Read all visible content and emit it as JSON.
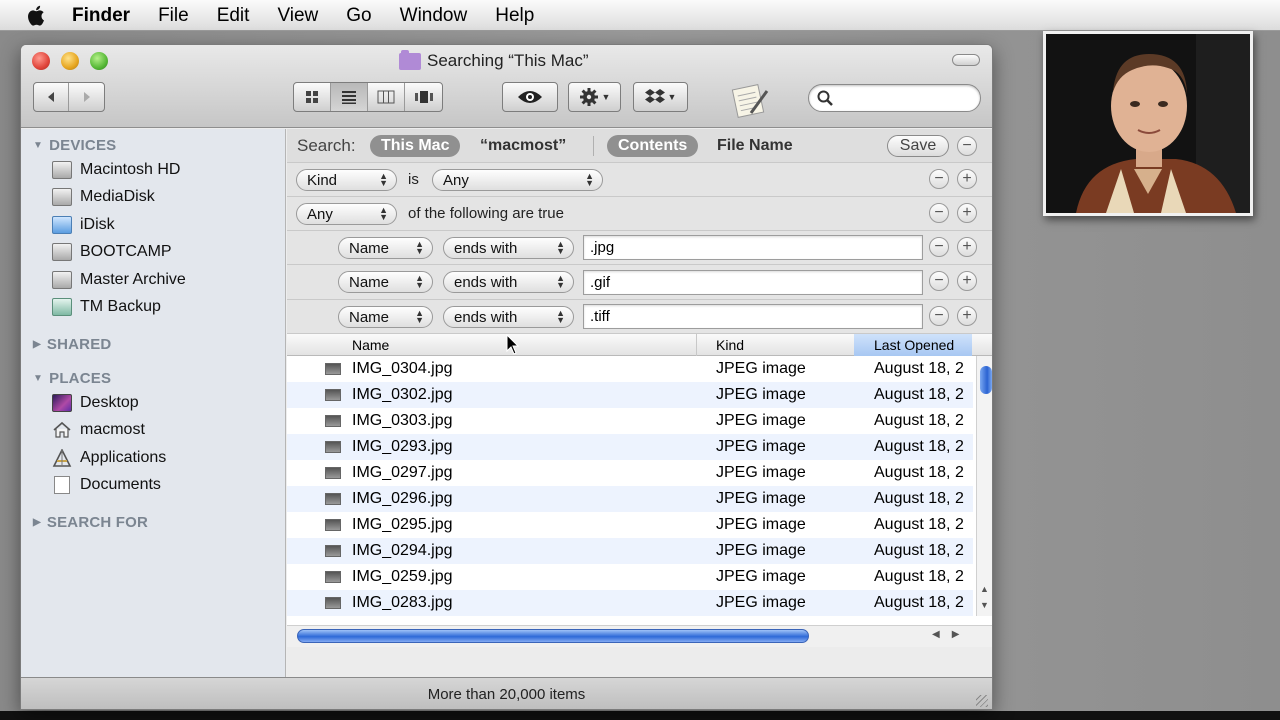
{
  "menubar": {
    "apple_icon": "apple-logo",
    "app_name": "Finder",
    "items": [
      "File",
      "Edit",
      "View",
      "Go",
      "Window",
      "Help"
    ]
  },
  "window": {
    "title": "Searching “This Mac”",
    "status": "More than 20,000 items"
  },
  "toolbar": {
    "back_icon": "back-arrow-icon",
    "forward_icon": "forward-arrow-icon",
    "view_modes": [
      "icon-view",
      "list-view",
      "column-view",
      "cover-flow-view"
    ],
    "active_view": "list-view",
    "quick_look_icon": "eye-icon",
    "action_icon": "gear-icon",
    "dropbox_icon": "dropbox-icon",
    "search": {
      "placeholder": "",
      "value": ""
    }
  },
  "sidebar": {
    "sections": [
      {
        "title": "DEVICES",
        "expanded": true,
        "items": [
          "Macintosh HD",
          "MediaDisk",
          "iDisk",
          "BOOTCAMP",
          "Master Archive",
          "TM Backup"
        ]
      },
      {
        "title": "SHARED",
        "expanded": false,
        "items": []
      },
      {
        "title": "PLACES",
        "expanded": true,
        "items": [
          "Desktop",
          "macmost",
          "Applications",
          "Documents"
        ]
      },
      {
        "title": "SEARCH FOR",
        "expanded": false,
        "items": []
      }
    ]
  },
  "search_bar": {
    "label": "Search:",
    "scope_active": "This Mac",
    "scope_other": "“macmost”",
    "attr_active": "Contents",
    "attr_other": "File Name",
    "save_label": "Save"
  },
  "criteria": {
    "row1": {
      "attribute": "Kind",
      "operator": "is",
      "value": "Any"
    },
    "row2": {
      "match": "Any",
      "text": "of the following are true"
    },
    "subrows": [
      {
        "attribute": "Name",
        "operator": "ends with",
        "value": ".jpg"
      },
      {
        "attribute": "Name",
        "operator": "ends with",
        "value": ".gif"
      },
      {
        "attribute": "Name",
        "operator": "ends with",
        "value": ".tiff"
      }
    ]
  },
  "file_list": {
    "columns": [
      "Name",
      "Kind",
      "Last Opened"
    ],
    "sorted_column": "Last Opened",
    "rows": [
      {
        "name": "IMG_0304.jpg",
        "kind": "JPEG image",
        "date": "August 18, 2"
      },
      {
        "name": "IMG_0302.jpg",
        "kind": "JPEG image",
        "date": "August 18, 2"
      },
      {
        "name": "IMG_0303.jpg",
        "kind": "JPEG image",
        "date": "August 18, 2"
      },
      {
        "name": "IMG_0293.jpg",
        "kind": "JPEG image",
        "date": "August 18, 2"
      },
      {
        "name": "IMG_0297.jpg",
        "kind": "JPEG image",
        "date": "August 18, 2"
      },
      {
        "name": "IMG_0296.jpg",
        "kind": "JPEG image",
        "date": "August 18, 2"
      },
      {
        "name": "IMG_0295.jpg",
        "kind": "JPEG image",
        "date": "August 18, 2"
      },
      {
        "name": "IMG_0294.jpg",
        "kind": "JPEG image",
        "date": "August 18, 2"
      },
      {
        "name": "IMG_0259.jpg",
        "kind": "JPEG image",
        "date": "August 18, 2"
      },
      {
        "name": "IMG_0283.jpg",
        "kind": "JPEG image",
        "date": "August 18, 2"
      }
    ]
  },
  "colors": {
    "selection_blue": "#2e6ad8",
    "row_alt": "#edf3fe",
    "sidebar_bg": "#e3e7ed"
  }
}
